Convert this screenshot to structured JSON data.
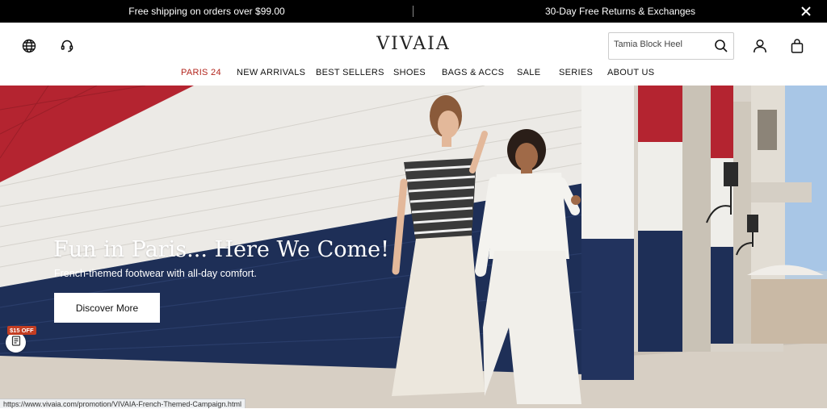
{
  "announcement": {
    "left_text": "Free shipping on orders over $99.00",
    "right_text": "30-Day Free Returns & Exchanges",
    "close_icon": "close-icon"
  },
  "header": {
    "logo": "VIVAIA",
    "icons": [
      "globe-icon",
      "headset-icon",
      "search-icon",
      "user-icon",
      "bag-icon"
    ],
    "search": {
      "placeholder": "Tamia Block Heel"
    }
  },
  "nav": {
    "items": [
      {
        "label": "PARIS 24"
      },
      {
        "label": "NEW ARRIVALS"
      },
      {
        "label": "BEST SELLERS"
      },
      {
        "label": "SHOES"
      },
      {
        "label": "BAGS & ACCS"
      },
      {
        "label": "SALE"
      },
      {
        "label": "SERIES"
      },
      {
        "label": "ABOUT US"
      }
    ],
    "accent_color": "#b3261e"
  },
  "hero": {
    "title": "Fun in Paris... Here We Come!",
    "subtitle": "French-themed footwear with all-day comfort.",
    "button_label": "Discover More"
  },
  "coupon": {
    "badge": "$15 OFF",
    "icon": "coupon-icon"
  },
  "status_bar": {
    "url": "https://www.vivaia.com/promotion/VIVAIA-French-Themed-Campaign.html"
  },
  "colors": {
    "announcement_bg": "#000000",
    "accent": "#b3261e",
    "wall_blue": "#1e2f57",
    "wall_red": "#b42430",
    "coupon_badge": "#c33d22"
  }
}
